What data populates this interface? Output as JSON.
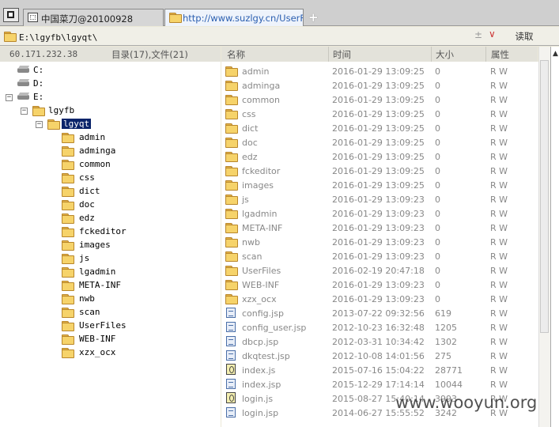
{
  "tabs": [
    {
      "label": "中国菜刀@20100928",
      "active": false
    },
    {
      "label": "http://www.suzlgy.cn/UserFil...",
      "active": true
    }
  ],
  "new_tab_label": "+",
  "address": {
    "path": "E:\\lgyfb\\lgyqt\\",
    "spin": "±",
    "dropdown": "∨",
    "read_button": "读取"
  },
  "left_header": {
    "ip": "60.171.232.38",
    "counts": "目录(17),文件(21)"
  },
  "tree": {
    "drives": [
      "C:",
      "D:",
      "E:"
    ],
    "level1": "lgyfb",
    "level2": "lgyqt",
    "folders": [
      "admin",
      "adminga",
      "common",
      "css",
      "dict",
      "doc",
      "edz",
      "fckeditor",
      "images",
      "js",
      "lgadmin",
      "META-INF",
      "nwb",
      "scan",
      "UserFiles",
      "WEB-INF",
      "xzx_ocx"
    ]
  },
  "columns": {
    "name": "名称",
    "time": "时间",
    "size": "大小",
    "attr": "属性"
  },
  "rows": [
    {
      "type": "folder",
      "name": "admin",
      "time": "2016-01-29 13:09:25",
      "size": "0",
      "attr": "R W"
    },
    {
      "type": "folder",
      "name": "adminga",
      "time": "2016-01-29 13:09:25",
      "size": "0",
      "attr": "R W"
    },
    {
      "type": "folder",
      "name": "common",
      "time": "2016-01-29 13:09:25",
      "size": "0",
      "attr": "R W"
    },
    {
      "type": "folder",
      "name": "css",
      "time": "2016-01-29 13:09:25",
      "size": "0",
      "attr": "R W"
    },
    {
      "type": "folder",
      "name": "dict",
      "time": "2016-01-29 13:09:25",
      "size": "0",
      "attr": "R W"
    },
    {
      "type": "folder",
      "name": "doc",
      "time": "2016-01-29 13:09:25",
      "size": "0",
      "attr": "R W"
    },
    {
      "type": "folder",
      "name": "edz",
      "time": "2016-01-29 13:09:25",
      "size": "0",
      "attr": "R W"
    },
    {
      "type": "folder",
      "name": "fckeditor",
      "time": "2016-01-29 13:09:25",
      "size": "0",
      "attr": "R W"
    },
    {
      "type": "folder",
      "name": "images",
      "time": "2016-01-29 13:09:25",
      "size": "0",
      "attr": "R W"
    },
    {
      "type": "folder",
      "name": "js",
      "time": "2016-01-29 13:09:23",
      "size": "0",
      "attr": "R W"
    },
    {
      "type": "folder",
      "name": "lgadmin",
      "time": "2016-01-29 13:09:23",
      "size": "0",
      "attr": "R W"
    },
    {
      "type": "folder",
      "name": "META-INF",
      "time": "2016-01-29 13:09:23",
      "size": "0",
      "attr": "R W"
    },
    {
      "type": "folder",
      "name": "nwb",
      "time": "2016-01-29 13:09:23",
      "size": "0",
      "attr": "R W"
    },
    {
      "type": "folder",
      "name": "scan",
      "time": "2016-01-29 13:09:23",
      "size": "0",
      "attr": "R W"
    },
    {
      "type": "folder",
      "name": "UserFiles",
      "time": "2016-02-19 20:47:18",
      "size": "0",
      "attr": "R W"
    },
    {
      "type": "folder",
      "name": "WEB-INF",
      "time": "2016-01-29 13:09:23",
      "size": "0",
      "attr": "R W"
    },
    {
      "type": "folder",
      "name": "xzx_ocx",
      "time": "2016-01-29 13:09:23",
      "size": "0",
      "attr": "R W"
    },
    {
      "type": "file",
      "name": "config.jsp",
      "time": "2013-07-22 09:32:56",
      "size": "619",
      "attr": "R W"
    },
    {
      "type": "file",
      "name": "config_user.jsp",
      "time": "2012-10-23 16:32:48",
      "size": "1205",
      "attr": "R W"
    },
    {
      "type": "file",
      "name": "dbcp.jsp",
      "time": "2012-03-31 10:34:42",
      "size": "1302",
      "attr": "R W"
    },
    {
      "type": "file",
      "name": "dkqtest.jsp",
      "time": "2012-10-08 14:01:56",
      "size": "275",
      "attr": "R W"
    },
    {
      "type": "js",
      "name": "index.js",
      "time": "2015-07-16 15:04:22",
      "size": "28771",
      "attr": "R W"
    },
    {
      "type": "file",
      "name": "index.jsp",
      "time": "2015-12-29 17:14:14",
      "size": "10044",
      "attr": "R W"
    },
    {
      "type": "js",
      "name": "login.js",
      "time": "2015-08-27 15:40:14",
      "size": "3993",
      "attr": "R W"
    },
    {
      "type": "file",
      "name": "login.jsp",
      "time": "2014-06-27 15:55:52",
      "size": "3242",
      "attr": "R W"
    },
    {
      "type": "file",
      "name": "",
      "time": "",
      "size": "",
      "attr": ""
    }
  ],
  "watermark": "www.wooyun.org"
}
